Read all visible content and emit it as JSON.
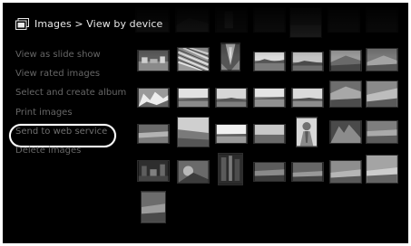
{
  "header": {
    "title": "Images > View by device",
    "icon": "images-icon"
  },
  "menu": {
    "items": [
      {
        "label": "View as slide show"
      },
      {
        "label": "View rated images"
      },
      {
        "label": "Select and create album"
      },
      {
        "label": "Print images"
      },
      {
        "label": "Send to web service",
        "selected": true
      },
      {
        "label": "Delete images"
      }
    ]
  },
  "colors": {
    "background": "#000000",
    "menu_text": "#666666",
    "header_text": "#e9e9e9",
    "selection_ring": "#ffffff"
  }
}
